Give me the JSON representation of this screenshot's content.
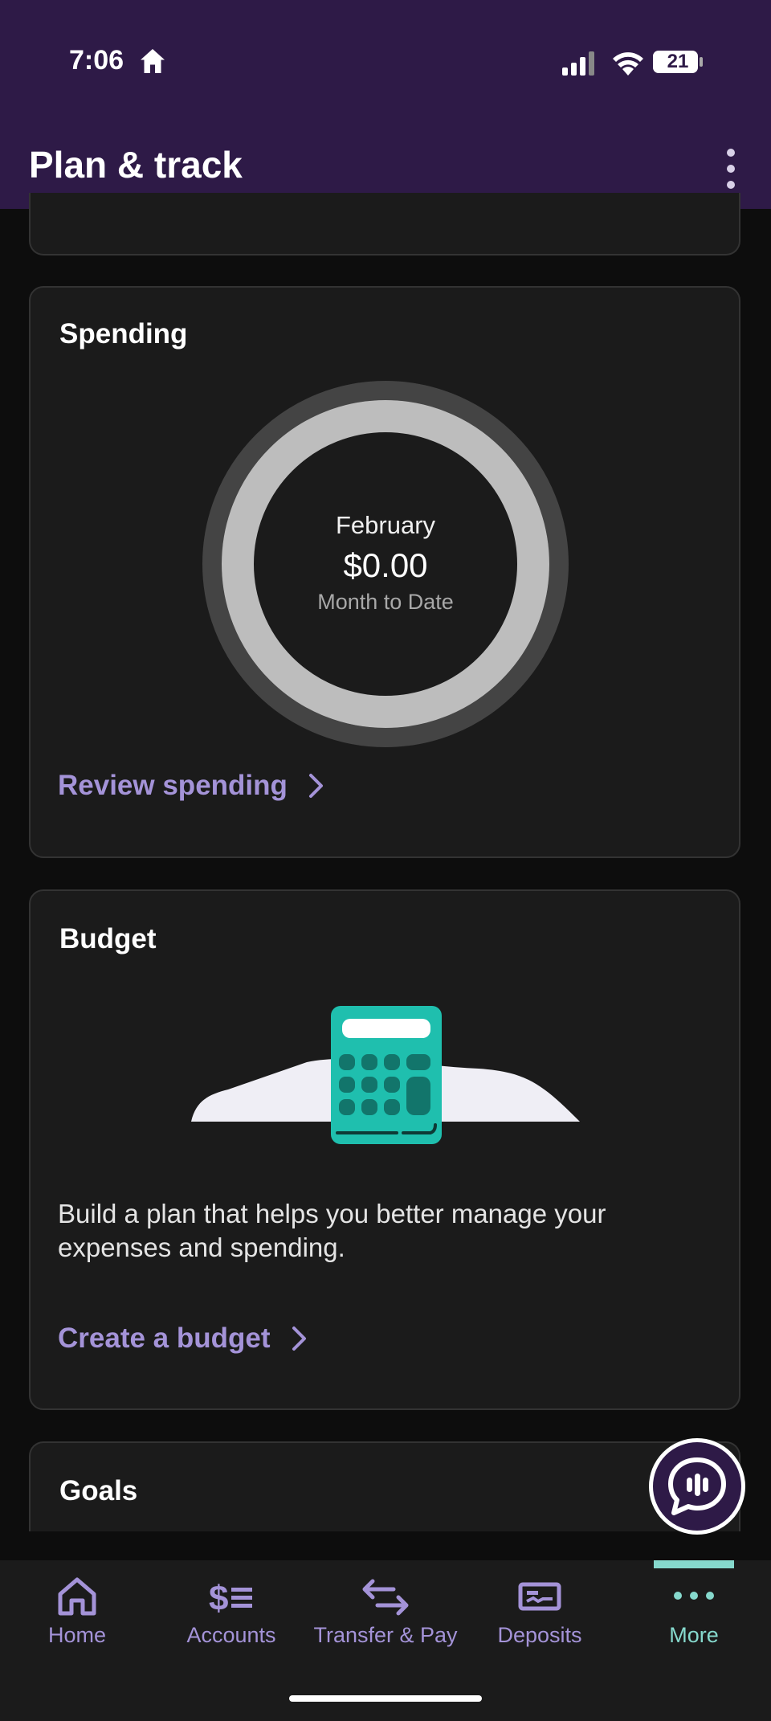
{
  "status_bar": {
    "time": "7:06",
    "battery": "21"
  },
  "header": {
    "title": "Plan & track"
  },
  "spending": {
    "title": "Spending",
    "month": "February",
    "amount": "$0.00",
    "period": "Month to Date",
    "link": "Review spending"
  },
  "budget": {
    "title": "Budget",
    "description": "Build a plan that helps you better manage your expenses and spending.",
    "link": "Create a budget"
  },
  "goals": {
    "title": "Goals"
  },
  "bottom_nav": {
    "items": [
      {
        "label": "Home",
        "icon": "home-icon"
      },
      {
        "label": "Accounts",
        "icon": "accounts-icon"
      },
      {
        "label": "Transfer & Pay",
        "icon": "transfer-icon"
      },
      {
        "label": "Deposits",
        "icon": "deposits-icon"
      },
      {
        "label": "More",
        "icon": "more-icon"
      }
    ],
    "active": "More"
  },
  "colors": {
    "header_bg": "#2e1a47",
    "accent_link": "#a493d8",
    "active_nav": "#86d9cd",
    "calculator": "#1fbfae"
  }
}
